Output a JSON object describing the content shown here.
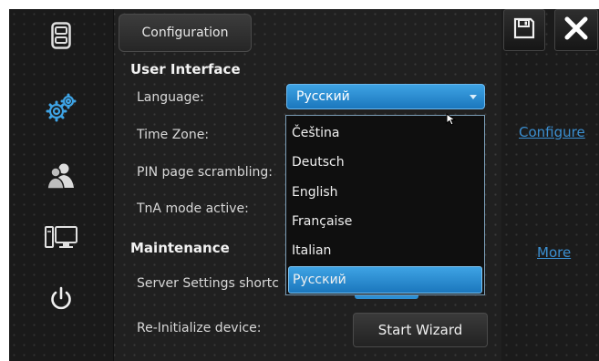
{
  "colors": {
    "accent": "#2a8fd8",
    "link": "#3b8fd1",
    "background": "#202020"
  },
  "sidebar": {
    "items": [
      {
        "icon": "card-reader-icon"
      },
      {
        "icon": "gears-icon",
        "active": true
      },
      {
        "icon": "users-icon"
      },
      {
        "icon": "computer-icon"
      },
      {
        "icon": "power-icon"
      }
    ]
  },
  "toolbar": {
    "save_icon": "floppy-disk-icon",
    "close_icon": "close-icon"
  },
  "tab": {
    "label": "Configuration"
  },
  "user_interface": {
    "title": "User Interface",
    "language_label": "Language:",
    "language_value": "Русский",
    "time_zone_label": "Time Zone:",
    "time_zone_link": "Configure",
    "pin_scrambling_label": "PIN page scrambling:",
    "tna_label": "TnA mode active:"
  },
  "maintenance": {
    "title": "Maintenance",
    "more_link": "More",
    "server_settings_label": "Server Settings shortc",
    "reinit_label": "Re-Initialize device:",
    "start_wizard_label": "Start Wizard"
  },
  "dropdown": {
    "options": [
      "Čeština",
      "Deutsch",
      "English",
      "Française",
      "Italian",
      "Русский"
    ],
    "selected": "Русский"
  }
}
